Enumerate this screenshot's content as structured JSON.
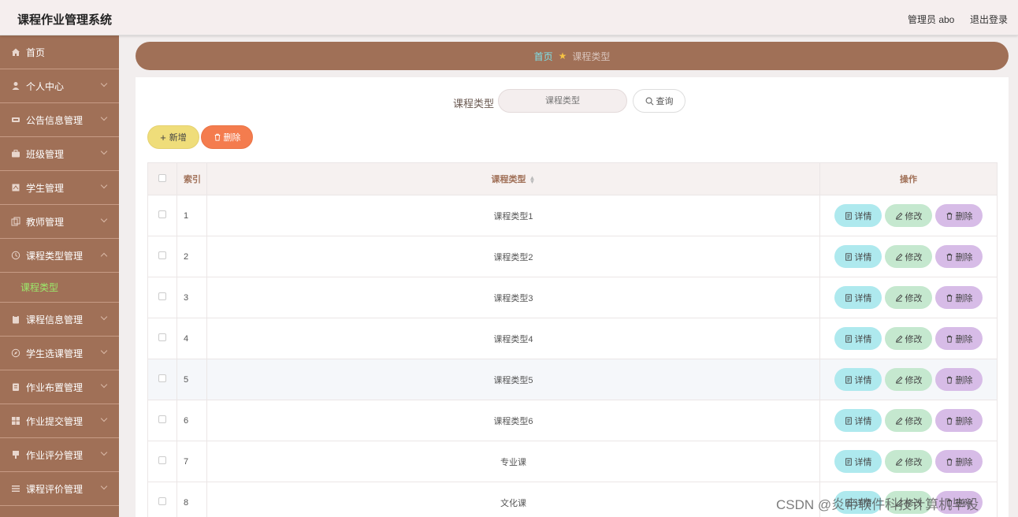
{
  "header": {
    "title": "课程作业管理系统",
    "user_label": "管理员 abo",
    "logout_label": "退出登录"
  },
  "sidebar": {
    "items": [
      {
        "label": "首页",
        "icon": "home-icon"
      },
      {
        "label": "个人中心",
        "icon": "user-icon"
      },
      {
        "label": "公告信息管理",
        "icon": "notice-icon"
      },
      {
        "label": "班级管理",
        "icon": "briefcase-icon"
      },
      {
        "label": "学生管理",
        "icon": "student-icon"
      },
      {
        "label": "教师管理",
        "icon": "teacher-icon"
      },
      {
        "label": "课程类型管理",
        "icon": "clock-icon"
      },
      {
        "label": "课程信息管理",
        "icon": "clipboard-icon"
      },
      {
        "label": "学生选课管理",
        "icon": "compass-icon"
      },
      {
        "label": "作业布置管理",
        "icon": "document-icon"
      },
      {
        "label": "作业提交管理",
        "icon": "grid-icon"
      },
      {
        "label": "作业评分管理",
        "icon": "score-icon"
      },
      {
        "label": "课程评价管理",
        "icon": "list-icon"
      }
    ],
    "active_sub": "课程类型"
  },
  "breadcrumb": {
    "home": "首页",
    "current": "课程类型"
  },
  "search": {
    "label": "课程类型",
    "placeholder": "课程类型",
    "button": "查询"
  },
  "actions": {
    "add": "新增",
    "delete": "删除"
  },
  "table": {
    "headers": {
      "index": "索引",
      "type": "课程类型",
      "ops": "操作"
    },
    "op_labels": {
      "view": "详情",
      "edit": "修改",
      "delete": "删除"
    },
    "rows": [
      {
        "index": "1",
        "type": "课程类型1"
      },
      {
        "index": "2",
        "type": "课程类型2"
      },
      {
        "index": "3",
        "type": "课程类型3"
      },
      {
        "index": "4",
        "type": "课程类型4"
      },
      {
        "index": "5",
        "type": "课程类型5"
      },
      {
        "index": "6",
        "type": "课程类型6"
      },
      {
        "index": "7",
        "type": "专业课"
      },
      {
        "index": "8",
        "type": "文化课"
      }
    ]
  },
  "watermark": "CSDN @炎帝软件科技计算机毕设",
  "colors": {
    "sidebar": "#a07057",
    "accent_green": "#9be86a",
    "add_button": "#efdd7a",
    "delete_button": "#f47c4e"
  }
}
